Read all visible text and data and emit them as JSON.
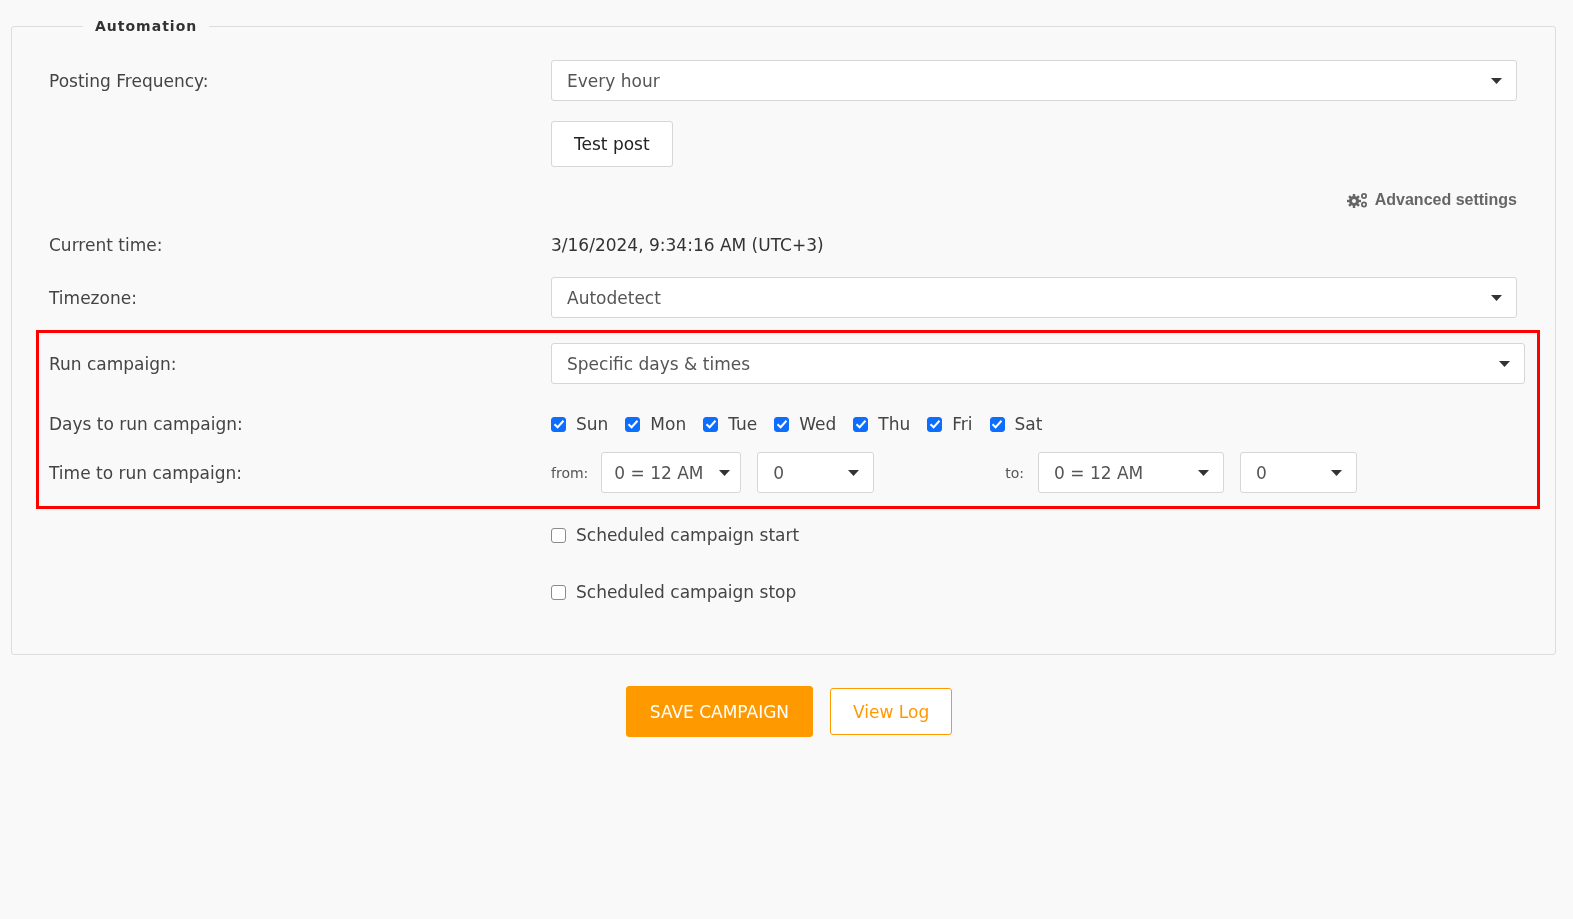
{
  "fieldset": {
    "legend": "Automation",
    "sections": [
      {
        "highlighted": false,
        "rows": [
          {
            "kind": "select",
            "label": "Posting Frequency:",
            "value": "Every hour"
          },
          {
            "kind": "button",
            "label": "Test post"
          },
          {
            "kind": "link",
            "label": "Advanced settings"
          },
          {
            "kind": "text",
            "label": "Current time:",
            "value": "3/16/2024, 9:34:16 AM (UTC+3)"
          },
          {
            "kind": "select",
            "label": "Timezone:",
            "value": "Autodetect"
          }
        ]
      },
      {
        "highlighted": true,
        "rows": [
          {
            "kind": "select",
            "label": "Run campaign:",
            "value": "Specific days & times"
          },
          {
            "kind": "days",
            "label": "Days to run campaign:",
            "days": [
              {
                "label": "Sun",
                "checked": true
              },
              {
                "label": "Mon",
                "checked": true
              },
              {
                "label": "Tue",
                "checked": true
              },
              {
                "label": "Wed",
                "checked": true
              },
              {
                "label": "Thu",
                "checked": true
              },
              {
                "label": "Fri",
                "checked": true
              },
              {
                "label": "Sat",
                "checked": true
              }
            ]
          },
          {
            "kind": "time",
            "label": "Time to run campaign:",
            "from_label": "from:",
            "from_hour": "0 = 12 AM",
            "from_minute": "0",
            "to_label": "to:",
            "to_hour": "0 = 12 AM",
            "to_minute": "0"
          }
        ]
      },
      {
        "highlighted": false,
        "rows": [
          {
            "kind": "checkbox",
            "label": "Scheduled campaign start",
            "checked": false
          },
          {
            "kind": "checkbox",
            "label": "Scheduled campaign stop",
            "checked": false
          }
        ]
      }
    ]
  },
  "actions": [
    {
      "kind": "primary",
      "label": "SAVE CAMPAIGN"
    },
    {
      "kind": "outline",
      "label": "View Log"
    }
  ]
}
